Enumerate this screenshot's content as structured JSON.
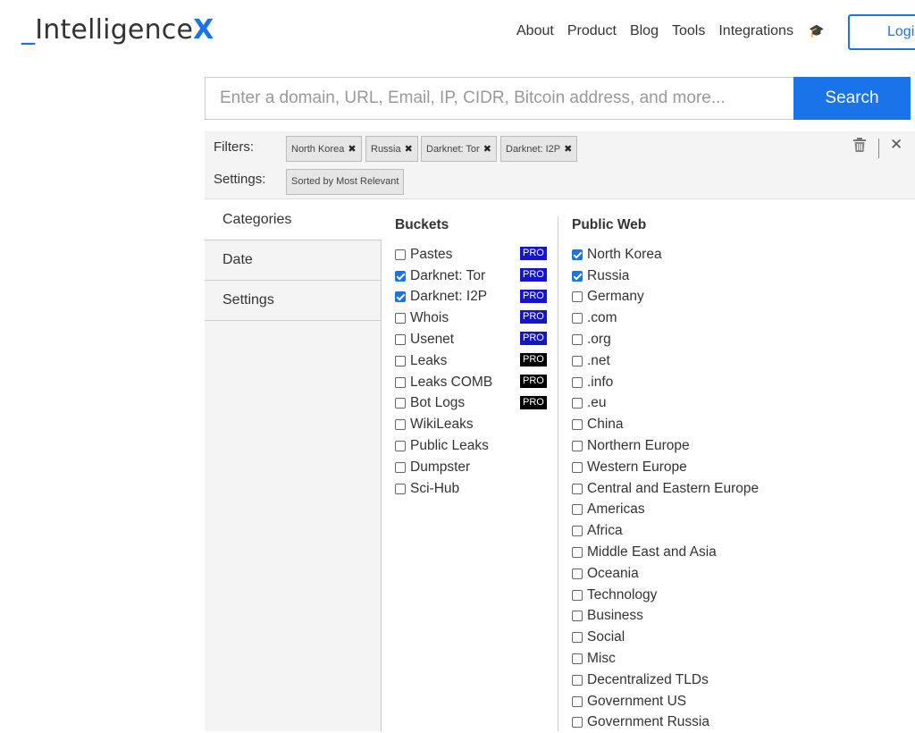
{
  "logo": {
    "prefix": "_",
    "name": "Intelligence",
    "suffix": "X"
  },
  "nav": {
    "items": [
      "About",
      "Product",
      "Blog",
      "Tools",
      "Integrations"
    ],
    "icon": "graduation-hat-icon",
    "login_label": "Login"
  },
  "search": {
    "placeholder": "Enter a domain, URL, Email, IP, CIDR, Bitcoin address, and more...",
    "button_label": "Search"
  },
  "filters": {
    "label": "Filters:",
    "chips": [
      "North Korea",
      "Russia",
      "Darknet: Tor",
      "Darknet: I2P"
    ],
    "settings_label": "Settings:",
    "settings_chip": "Sorted by Most Relevant"
  },
  "tabs": [
    "Categories",
    "Date",
    "Settings"
  ],
  "buckets": {
    "title": "Buckets",
    "items": [
      {
        "label": "Pastes",
        "checked": false,
        "pro": "PRO",
        "pro_color": "#1515c8"
      },
      {
        "label": "Darknet: Tor",
        "checked": true,
        "pro": "PRO",
        "pro_color": "#1515c8"
      },
      {
        "label": "Darknet: I2P",
        "checked": true,
        "pro": "PRO",
        "pro_color": "#1515c8"
      },
      {
        "label": "Whois",
        "checked": false,
        "pro": "PRO",
        "pro_color": "#1515c8"
      },
      {
        "label": "Usenet",
        "checked": false,
        "pro": "PRO",
        "pro_color": "#1515c8"
      },
      {
        "label": "Leaks",
        "checked": false,
        "pro": "PRO",
        "pro_color": "#000000"
      },
      {
        "label": "Leaks COMB",
        "checked": false,
        "pro": "PRO",
        "pro_color": "#000000"
      },
      {
        "label": "Bot Logs",
        "checked": false,
        "pro": "PRO",
        "pro_color": "#000000"
      },
      {
        "label": "WikiLeaks",
        "checked": false,
        "pro": "",
        "pro_color": ""
      },
      {
        "label": "Public Leaks",
        "checked": false,
        "pro": "",
        "pro_color": ""
      },
      {
        "label": "Dumpster",
        "checked": false,
        "pro": "",
        "pro_color": ""
      },
      {
        "label": "Sci-Hub",
        "checked": false,
        "pro": "",
        "pro_color": ""
      }
    ]
  },
  "public_web": {
    "title": "Public Web",
    "items": [
      {
        "label": "North Korea",
        "checked": true
      },
      {
        "label": "Russia",
        "checked": true
      },
      {
        "label": "Germany",
        "checked": false
      },
      {
        "label": ".com",
        "checked": false
      },
      {
        "label": ".org",
        "checked": false
      },
      {
        "label": ".net",
        "checked": false
      },
      {
        "label": ".info",
        "checked": false
      },
      {
        "label": ".eu",
        "checked": false
      },
      {
        "label": "China",
        "checked": false
      },
      {
        "label": "Northern Europe",
        "checked": false
      },
      {
        "label": "Western Europe",
        "checked": false
      },
      {
        "label": "Central and Eastern Europe",
        "checked": false
      },
      {
        "label": "Americas",
        "checked": false
      },
      {
        "label": "Africa",
        "checked": false
      },
      {
        "label": "Middle East and Asia",
        "checked": false
      },
      {
        "label": "Oceania",
        "checked": false
      },
      {
        "label": "Technology",
        "checked": false
      },
      {
        "label": "Business",
        "checked": false
      },
      {
        "label": "Social",
        "checked": false
      },
      {
        "label": "Misc",
        "checked": false
      },
      {
        "label": "Decentralized TLDs",
        "checked": false
      },
      {
        "label": "Government US",
        "checked": false
      },
      {
        "label": "Government Russia",
        "checked": false
      }
    ]
  },
  "colors": {
    "accent": "#1a73e8",
    "panel_bg": "#f4f4f4"
  }
}
